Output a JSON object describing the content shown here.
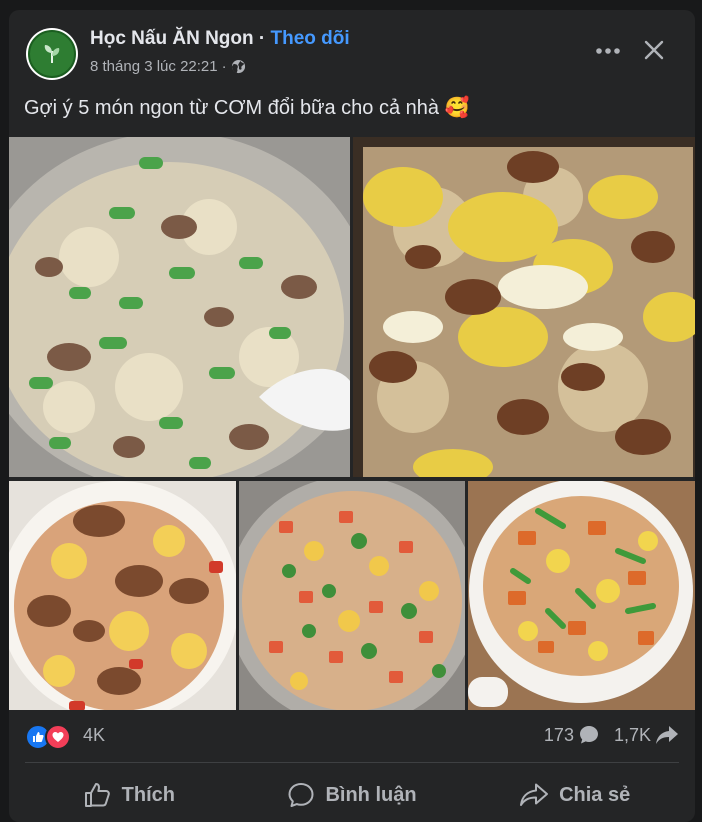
{
  "post": {
    "page_name": "Học Nấu ĂN Ngon",
    "separator": "·",
    "follow_label": "Theo dõi",
    "timestamp": "8 tháng 3 lúc 22:21",
    "meta_separator": "·",
    "audience_icon": "globe-icon",
    "caption": "Gợi ý 5 món ngon từ CƠM đổi bữa cho cả nhà 🥰"
  },
  "header_actions": {
    "more_icon": "more-horizontal-icon",
    "close_icon": "close-icon"
  },
  "photos": [
    {
      "subject": "fried rice with green beans and beef"
    },
    {
      "subject": "fried rice with cabbage and beef"
    },
    {
      "subject": "tomato fried rice with egg and beef"
    },
    {
      "subject": "fried rice with sausage, egg and herbs"
    },
    {
      "subject": "fried rice with sausage, egg and scallion"
    }
  ],
  "stats": {
    "reactions_count": "4K",
    "comments_count": "173",
    "shares_count": "1,7K",
    "colors": {
      "like": "#1877f2",
      "love": "#f33e58"
    }
  },
  "actions": {
    "like": "Thích",
    "comment": "Bình luận",
    "share": "Chia sẻ"
  },
  "colors": {
    "background": "#18191a",
    "card": "#242526",
    "accent": "#4599ff",
    "text": "#e4e6eb",
    "secondary_text": "#b0b3b8"
  }
}
